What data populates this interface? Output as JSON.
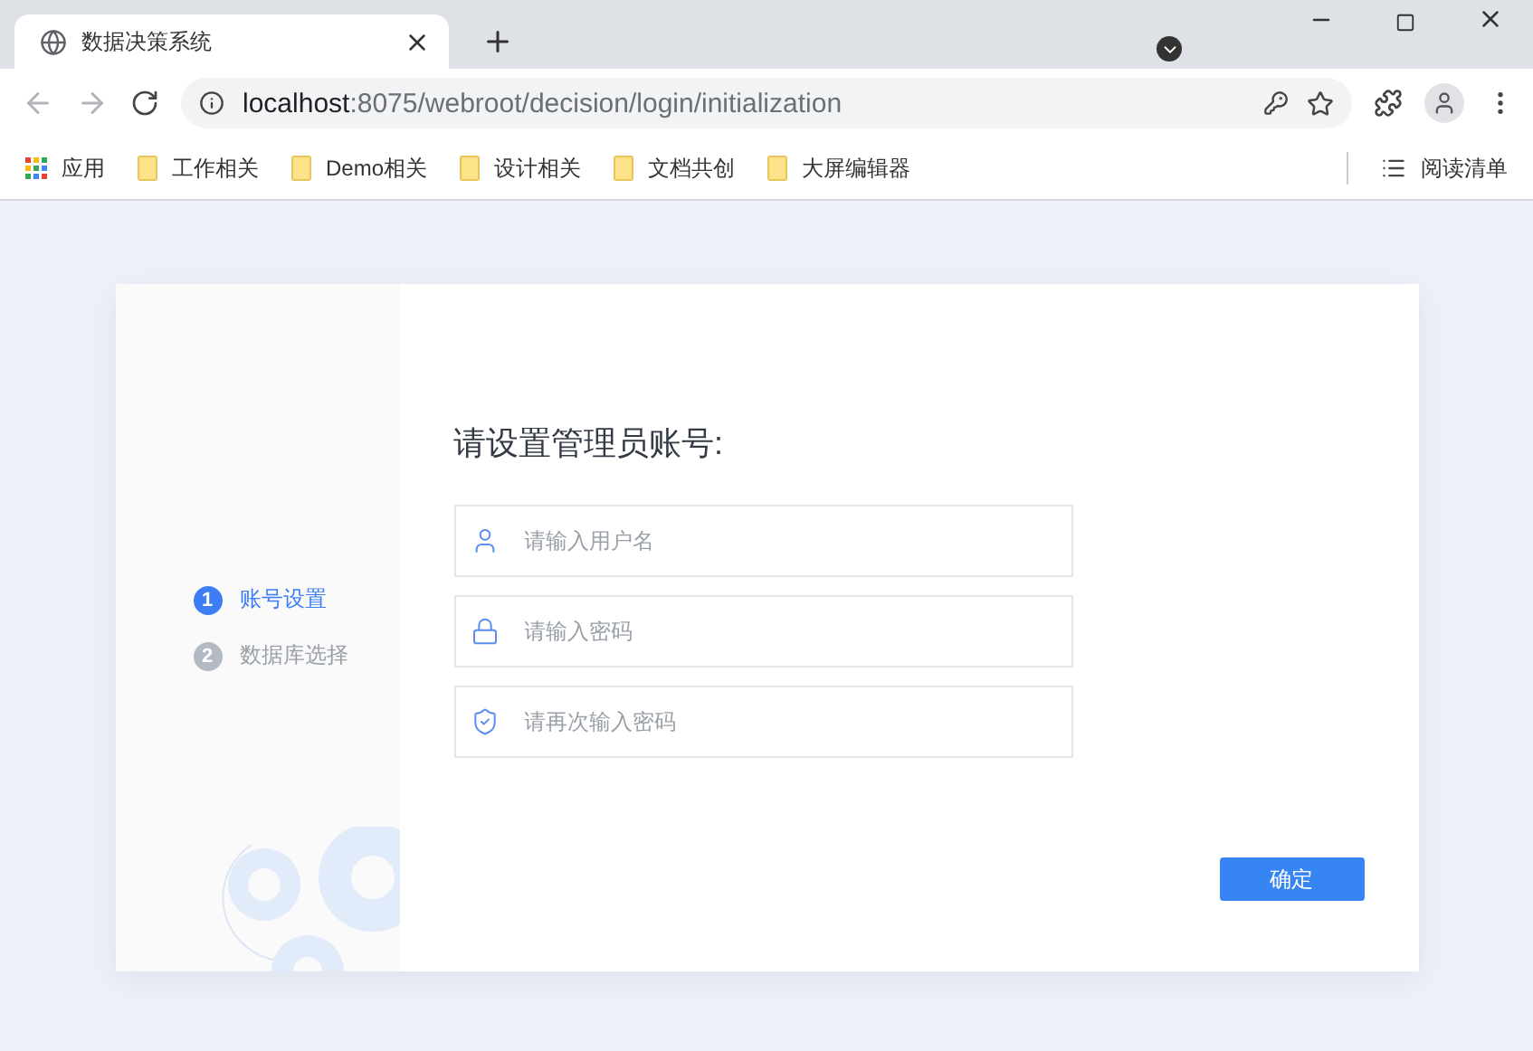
{
  "browser": {
    "tab": {
      "title": "数据决策系统"
    },
    "address": {
      "host": "localhost",
      "path": ":8075/webroot/decision/login/initialization"
    },
    "bookmarks": [
      {
        "kind": "apps",
        "label": "应用"
      },
      {
        "kind": "folder",
        "label": "工作相关"
      },
      {
        "kind": "folder",
        "label": "Demo相关"
      },
      {
        "kind": "folder",
        "label": "设计相关"
      },
      {
        "kind": "folder",
        "label": "文档共创"
      },
      {
        "kind": "folder",
        "label": "大屏编辑器"
      }
    ],
    "reading_list": "阅读清单"
  },
  "steps": [
    {
      "number": "1",
      "label": "账号设置",
      "selected": true
    },
    {
      "number": "2",
      "label": "数据库选择",
      "selected": false
    }
  ],
  "form": {
    "title": "请设置管理员账号:",
    "fields": [
      {
        "kind": "user",
        "placeholder": "请输入用户名"
      },
      {
        "kind": "password",
        "placeholder": "请输入密码"
      },
      {
        "kind": "confirm",
        "placeholder": "请再次输入密码"
      }
    ],
    "submit": "确定"
  }
}
